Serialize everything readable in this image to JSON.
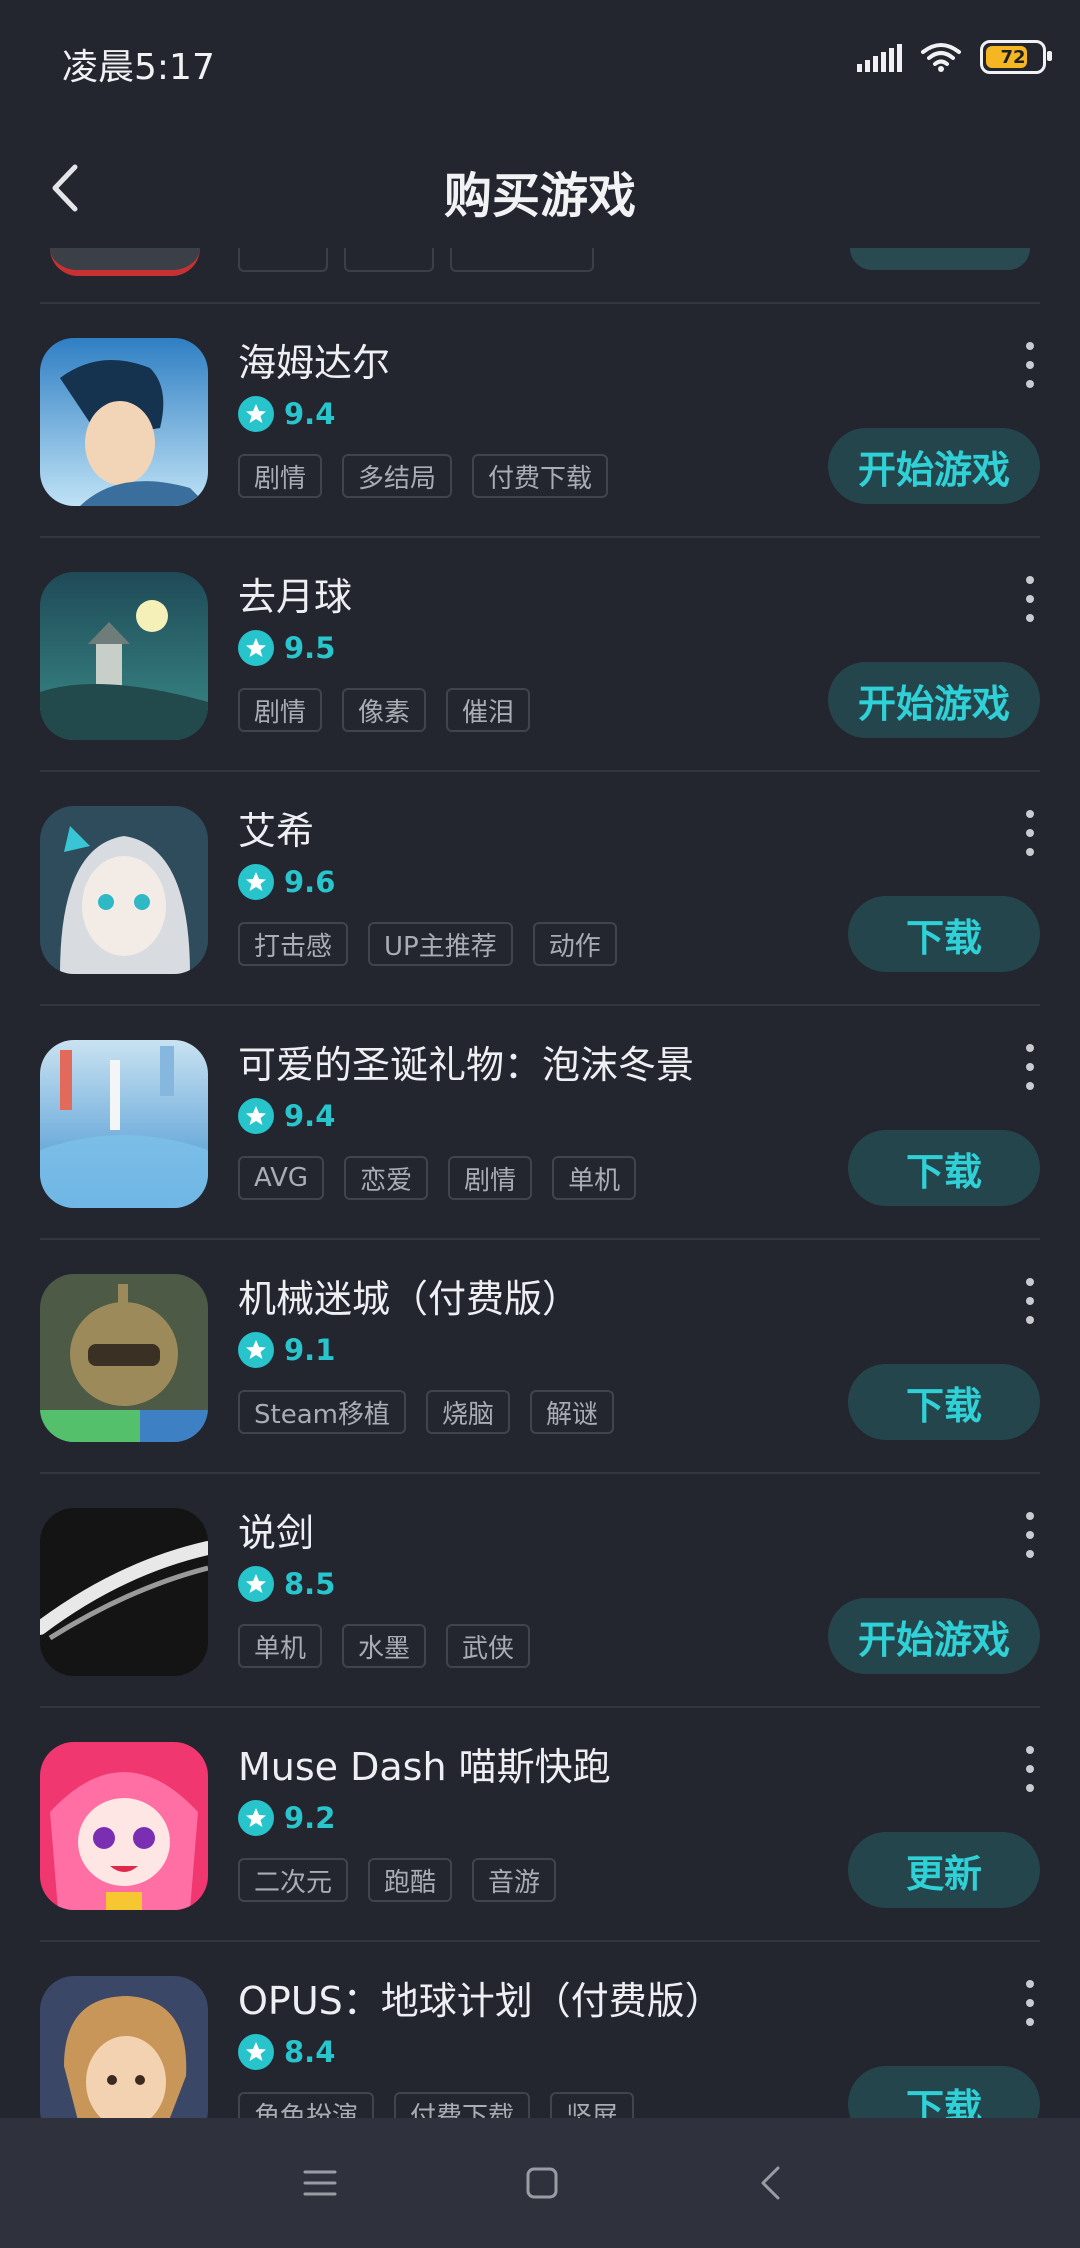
{
  "status_bar": {
    "time": "凌晨5:17",
    "battery": "72"
  },
  "header": {
    "title": "购买游戏"
  },
  "colors": {
    "accent": "#28c5cd",
    "button_bg": "#25454d",
    "background": "#23252f"
  },
  "games": [
    {
      "name": "海姆达尔",
      "rating": "9.4",
      "tags": [
        "剧情",
        "多结局",
        "付费下载"
      ],
      "action": "开始游戏"
    },
    {
      "name": "去月球",
      "rating": "9.5",
      "tags": [
        "剧情",
        "像素",
        "催泪"
      ],
      "action": "开始游戏"
    },
    {
      "name": "艾希",
      "rating": "9.6",
      "tags": [
        "打击感",
        "UP主推荐",
        "动作"
      ],
      "action": "下载"
    },
    {
      "name": "可爱的圣诞礼物：泡沫冬景",
      "rating": "9.4",
      "tags": [
        "AVG",
        "恋爱",
        "剧情",
        "单机"
      ],
      "action": "下载"
    },
    {
      "name": "机械迷城（付费版）",
      "rating": "9.1",
      "tags": [
        "Steam移植",
        "烧脑",
        "解谜"
      ],
      "action": "下载"
    },
    {
      "name": "说剑",
      "rating": "8.5",
      "tags": [
        "单机",
        "水墨",
        "武侠"
      ],
      "action": "开始游戏"
    },
    {
      "name": "Muse Dash 喵斯快跑",
      "rating": "9.2",
      "tags": [
        "二次元",
        "跑酷",
        "音游"
      ],
      "action": "更新"
    },
    {
      "name": "OPUS：地球计划（付费版）",
      "rating": "8.4",
      "tags": [
        "角色扮演",
        "付费下载",
        "坚屏"
      ],
      "action": "下载"
    }
  ],
  "nav": {
    "items": [
      "menu-icon",
      "home-icon",
      "back-icon"
    ]
  }
}
